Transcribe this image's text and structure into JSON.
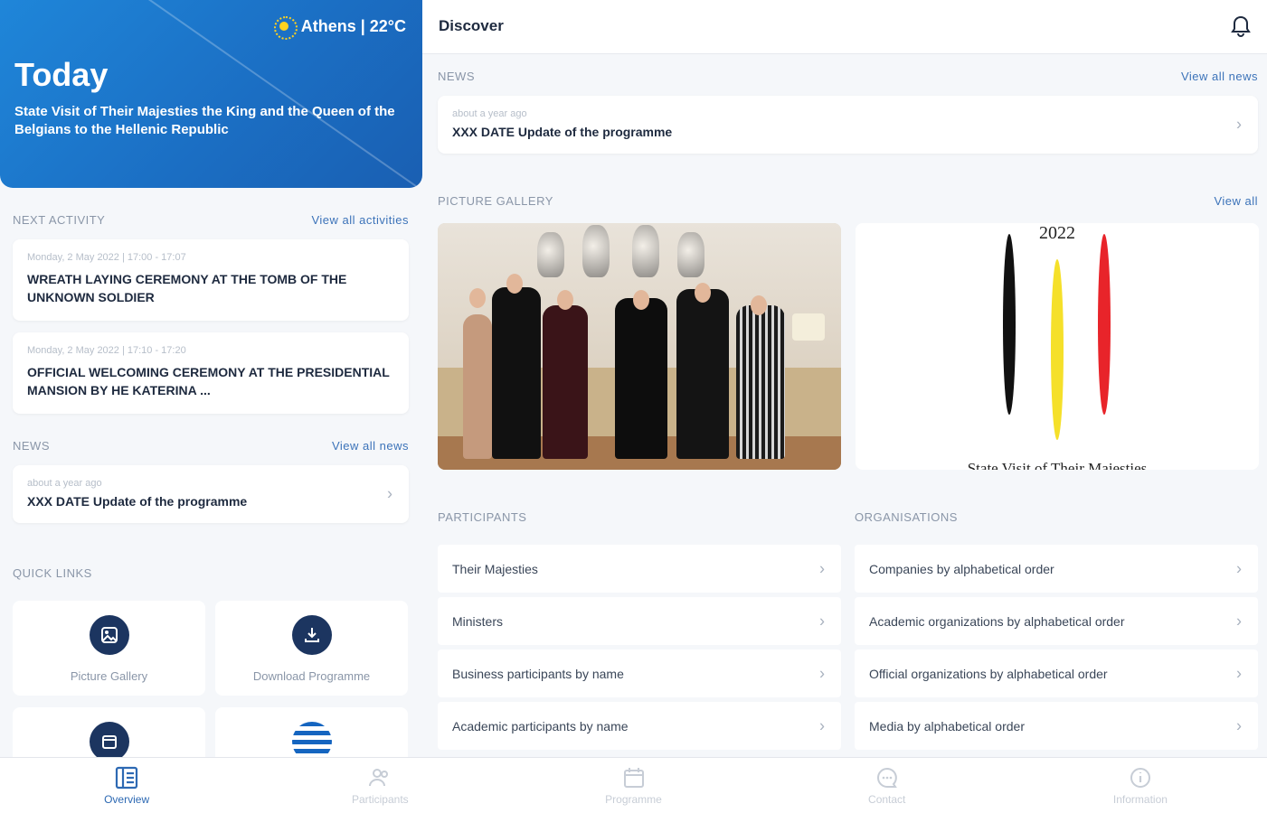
{
  "hero": {
    "weather": "Athens | 22°C",
    "title": "Today",
    "subtitle": "State Visit of Their Majesties the King and the Queen of the Belgians to the Hellenic Republic"
  },
  "next_activity": {
    "label": "NEXT ACTIVITY",
    "link": "View all activities",
    "items": [
      {
        "date": "Monday, 2 May 2022 | 17:00 - 17:07",
        "title": "WREATH LAYING CEREMONY AT THE TOMB OF THE UNKNOWN SOLDIER"
      },
      {
        "date": "Monday, 2 May 2022 | 17:10 - 17:20",
        "title": "OFFICIAL WELCOMING CEREMONY AT THE PRESIDENTIAL MANSION BY HE KATERINA ..."
      }
    ]
  },
  "left_news": {
    "label": "NEWS",
    "link": "View all news",
    "item": {
      "meta": "about a year ago",
      "title": "XXX DATE Update of the programme"
    }
  },
  "quick_links": {
    "label": "QUICK LINKS",
    "items": [
      {
        "label": "Picture Gallery",
        "icon": "image-icon"
      },
      {
        "label": "Download Programme",
        "icon": "download-icon"
      }
    ]
  },
  "discover": {
    "title": "Discover",
    "news": {
      "label": "NEWS",
      "link": "View all news",
      "item": {
        "meta": "about a year ago",
        "title": "XXX DATE Update of the programme"
      }
    },
    "gallery": {
      "label": "PICTURE GALLERY",
      "link": "View all",
      "logo_year": "2022",
      "logo_caption": "State Visit of Their Majesties",
      "colors": {
        "black": "#111111",
        "yellow": "#f5e02a",
        "red": "#e8242a"
      }
    },
    "participants": {
      "label": "PARTICIPANTS",
      "items": [
        "Their Majesties",
        "Ministers",
        "Business participants by name",
        "Academic participants by name"
      ]
    },
    "organisations": {
      "label": "ORGANISATIONS",
      "items": [
        "Companies by alphabetical order",
        "Academic organizations by alphabetical order",
        "Official organizations by alphabetical order",
        "Media by alphabetical order"
      ]
    }
  },
  "nav": {
    "items": [
      "Overview",
      "Participants",
      "Programme",
      "Contact",
      "Information"
    ],
    "active_color": "#2d69b3"
  }
}
